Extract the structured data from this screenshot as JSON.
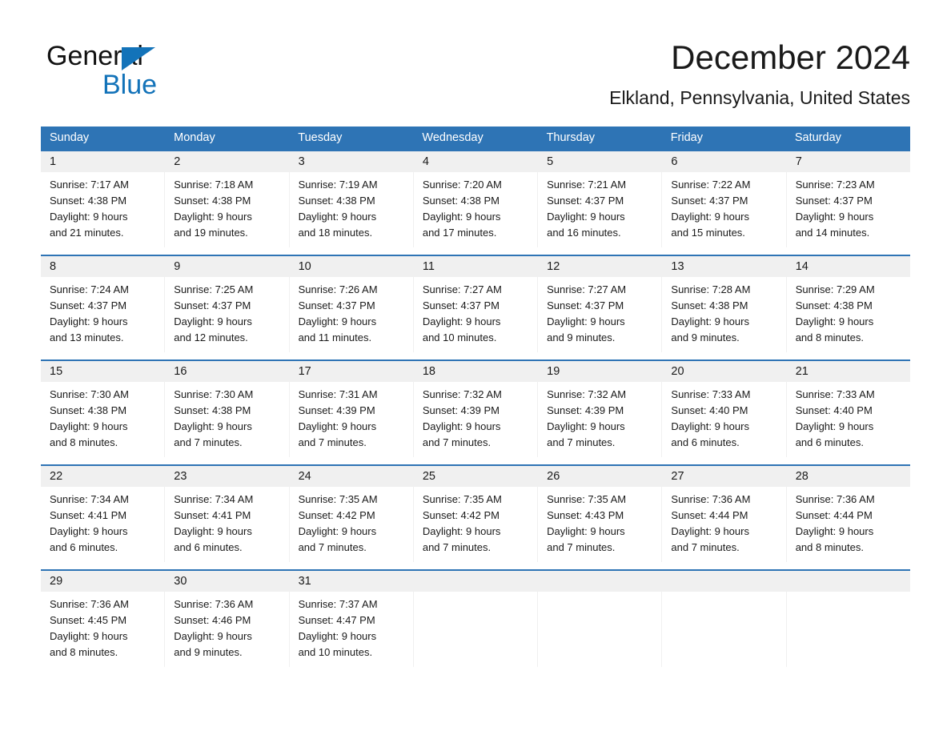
{
  "brand": {
    "word_one": "General",
    "word_two": "Blue",
    "triangle_icon": "blue-triangle-icon",
    "accent_color": "#1373b9"
  },
  "header": {
    "title": "December 2024",
    "location": "Elkland, Pennsylvania, United States"
  },
  "theme": {
    "header_band": "#2e74b5",
    "day_band": "#f0f0f0",
    "rule": "#2e74b5",
    "text": "#1a1a1a",
    "page_bg": "#ffffff"
  },
  "weekdays": [
    "Sunday",
    "Monday",
    "Tuesday",
    "Wednesday",
    "Thursday",
    "Friday",
    "Saturday"
  ],
  "labels": {
    "sunrise_prefix": "Sunrise:",
    "sunset_prefix": "Sunset:",
    "daylight_prefix": "Daylight:"
  },
  "weeks": [
    [
      {
        "day": "1",
        "sunrise": "Sunrise: 7:17 AM",
        "sunset": "Sunset: 4:38 PM",
        "daylight_line1": "Daylight: 9 hours",
        "daylight_line2": "and 21 minutes."
      },
      {
        "day": "2",
        "sunrise": "Sunrise: 7:18 AM",
        "sunset": "Sunset: 4:38 PM",
        "daylight_line1": "Daylight: 9 hours",
        "daylight_line2": "and 19 minutes."
      },
      {
        "day": "3",
        "sunrise": "Sunrise: 7:19 AM",
        "sunset": "Sunset: 4:38 PM",
        "daylight_line1": "Daylight: 9 hours",
        "daylight_line2": "and 18 minutes."
      },
      {
        "day": "4",
        "sunrise": "Sunrise: 7:20 AM",
        "sunset": "Sunset: 4:38 PM",
        "daylight_line1": "Daylight: 9 hours",
        "daylight_line2": "and 17 minutes."
      },
      {
        "day": "5",
        "sunrise": "Sunrise: 7:21 AM",
        "sunset": "Sunset: 4:37 PM",
        "daylight_line1": "Daylight: 9 hours",
        "daylight_line2": "and 16 minutes."
      },
      {
        "day": "6",
        "sunrise": "Sunrise: 7:22 AM",
        "sunset": "Sunset: 4:37 PM",
        "daylight_line1": "Daylight: 9 hours",
        "daylight_line2": "and 15 minutes."
      },
      {
        "day": "7",
        "sunrise": "Sunrise: 7:23 AM",
        "sunset": "Sunset: 4:37 PM",
        "daylight_line1": "Daylight: 9 hours",
        "daylight_line2": "and 14 minutes."
      }
    ],
    [
      {
        "day": "8",
        "sunrise": "Sunrise: 7:24 AM",
        "sunset": "Sunset: 4:37 PM",
        "daylight_line1": "Daylight: 9 hours",
        "daylight_line2": "and 13 minutes."
      },
      {
        "day": "9",
        "sunrise": "Sunrise: 7:25 AM",
        "sunset": "Sunset: 4:37 PM",
        "daylight_line1": "Daylight: 9 hours",
        "daylight_line2": "and 12 minutes."
      },
      {
        "day": "10",
        "sunrise": "Sunrise: 7:26 AM",
        "sunset": "Sunset: 4:37 PM",
        "daylight_line1": "Daylight: 9 hours",
        "daylight_line2": "and 11 minutes."
      },
      {
        "day": "11",
        "sunrise": "Sunrise: 7:27 AM",
        "sunset": "Sunset: 4:37 PM",
        "daylight_line1": "Daylight: 9 hours",
        "daylight_line2": "and 10 minutes."
      },
      {
        "day": "12",
        "sunrise": "Sunrise: 7:27 AM",
        "sunset": "Sunset: 4:37 PM",
        "daylight_line1": "Daylight: 9 hours",
        "daylight_line2": "and 9 minutes."
      },
      {
        "day": "13",
        "sunrise": "Sunrise: 7:28 AM",
        "sunset": "Sunset: 4:38 PM",
        "daylight_line1": "Daylight: 9 hours",
        "daylight_line2": "and 9 minutes."
      },
      {
        "day": "14",
        "sunrise": "Sunrise: 7:29 AM",
        "sunset": "Sunset: 4:38 PM",
        "daylight_line1": "Daylight: 9 hours",
        "daylight_line2": "and 8 minutes."
      }
    ],
    [
      {
        "day": "15",
        "sunrise": "Sunrise: 7:30 AM",
        "sunset": "Sunset: 4:38 PM",
        "daylight_line1": "Daylight: 9 hours",
        "daylight_line2": "and 8 minutes."
      },
      {
        "day": "16",
        "sunrise": "Sunrise: 7:30 AM",
        "sunset": "Sunset: 4:38 PM",
        "daylight_line1": "Daylight: 9 hours",
        "daylight_line2": "and 7 minutes."
      },
      {
        "day": "17",
        "sunrise": "Sunrise: 7:31 AM",
        "sunset": "Sunset: 4:39 PM",
        "daylight_line1": "Daylight: 9 hours",
        "daylight_line2": "and 7 minutes."
      },
      {
        "day": "18",
        "sunrise": "Sunrise: 7:32 AM",
        "sunset": "Sunset: 4:39 PM",
        "daylight_line1": "Daylight: 9 hours",
        "daylight_line2": "and 7 minutes."
      },
      {
        "day": "19",
        "sunrise": "Sunrise: 7:32 AM",
        "sunset": "Sunset: 4:39 PM",
        "daylight_line1": "Daylight: 9 hours",
        "daylight_line2": "and 7 minutes."
      },
      {
        "day": "20",
        "sunrise": "Sunrise: 7:33 AM",
        "sunset": "Sunset: 4:40 PM",
        "daylight_line1": "Daylight: 9 hours",
        "daylight_line2": "and 6 minutes."
      },
      {
        "day": "21",
        "sunrise": "Sunrise: 7:33 AM",
        "sunset": "Sunset: 4:40 PM",
        "daylight_line1": "Daylight: 9 hours",
        "daylight_line2": "and 6 minutes."
      }
    ],
    [
      {
        "day": "22",
        "sunrise": "Sunrise: 7:34 AM",
        "sunset": "Sunset: 4:41 PM",
        "daylight_line1": "Daylight: 9 hours",
        "daylight_line2": "and 6 minutes."
      },
      {
        "day": "23",
        "sunrise": "Sunrise: 7:34 AM",
        "sunset": "Sunset: 4:41 PM",
        "daylight_line1": "Daylight: 9 hours",
        "daylight_line2": "and 6 minutes."
      },
      {
        "day": "24",
        "sunrise": "Sunrise: 7:35 AM",
        "sunset": "Sunset: 4:42 PM",
        "daylight_line1": "Daylight: 9 hours",
        "daylight_line2": "and 7 minutes."
      },
      {
        "day": "25",
        "sunrise": "Sunrise: 7:35 AM",
        "sunset": "Sunset: 4:42 PM",
        "daylight_line1": "Daylight: 9 hours",
        "daylight_line2": "and 7 minutes."
      },
      {
        "day": "26",
        "sunrise": "Sunrise: 7:35 AM",
        "sunset": "Sunset: 4:43 PM",
        "daylight_line1": "Daylight: 9 hours",
        "daylight_line2": "and 7 minutes."
      },
      {
        "day": "27",
        "sunrise": "Sunrise: 7:36 AM",
        "sunset": "Sunset: 4:44 PM",
        "daylight_line1": "Daylight: 9 hours",
        "daylight_line2": "and 7 minutes."
      },
      {
        "day": "28",
        "sunrise": "Sunrise: 7:36 AM",
        "sunset": "Sunset: 4:44 PM",
        "daylight_line1": "Daylight: 9 hours",
        "daylight_line2": "and 8 minutes."
      }
    ],
    [
      {
        "day": "29",
        "sunrise": "Sunrise: 7:36 AM",
        "sunset": "Sunset: 4:45 PM",
        "daylight_line1": "Daylight: 9 hours",
        "daylight_line2": "and 8 minutes."
      },
      {
        "day": "30",
        "sunrise": "Sunrise: 7:36 AM",
        "sunset": "Sunset: 4:46 PM",
        "daylight_line1": "Daylight: 9 hours",
        "daylight_line2": "and 9 minutes."
      },
      {
        "day": "31",
        "sunrise": "Sunrise: 7:37 AM",
        "sunset": "Sunset: 4:47 PM",
        "daylight_line1": "Daylight: 9 hours",
        "daylight_line2": "and 10 minutes."
      },
      {
        "day": "",
        "sunrise": "",
        "sunset": "",
        "daylight_line1": "",
        "daylight_line2": ""
      },
      {
        "day": "",
        "sunrise": "",
        "sunset": "",
        "daylight_line1": "",
        "daylight_line2": ""
      },
      {
        "day": "",
        "sunrise": "",
        "sunset": "",
        "daylight_line1": "",
        "daylight_line2": ""
      },
      {
        "day": "",
        "sunrise": "",
        "sunset": "",
        "daylight_line1": "",
        "daylight_line2": ""
      }
    ]
  ]
}
